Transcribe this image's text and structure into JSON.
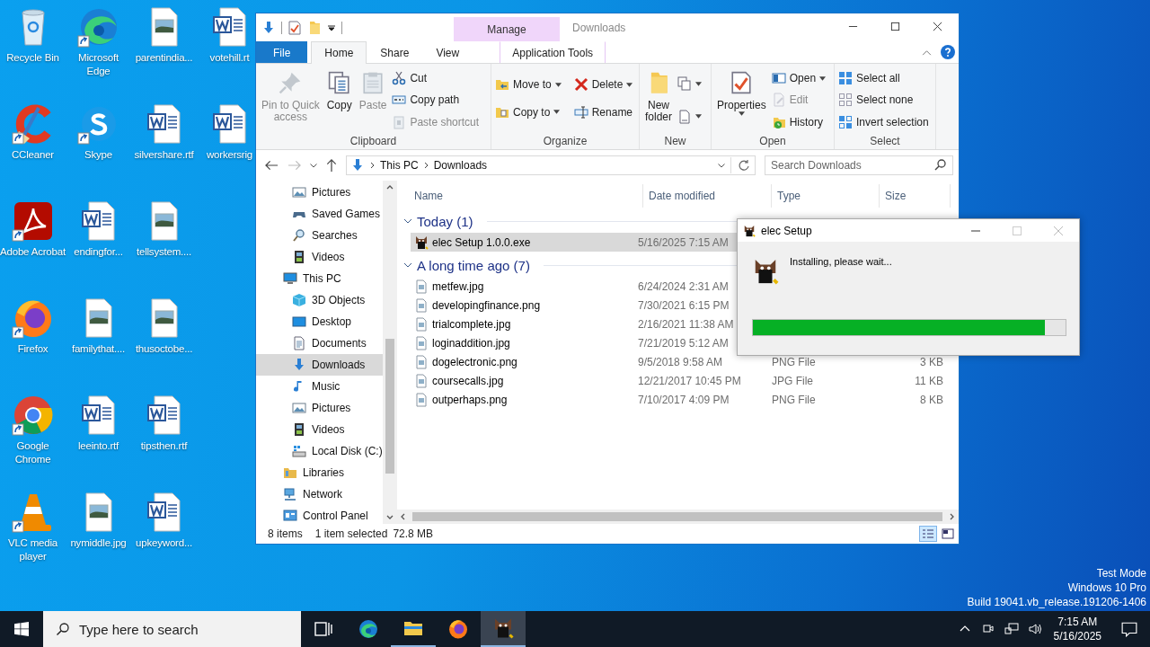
{
  "desktop": {
    "icons": [
      {
        "label": "Recycle Bin",
        "kind": "recycle",
        "shortcut": false
      },
      {
        "label": "CCleaner",
        "kind": "ccleaner",
        "shortcut": true
      },
      {
        "label": "Adobe Acrobat",
        "kind": "acrobat",
        "shortcut": true
      },
      {
        "label": "Firefox",
        "kind": "firefox",
        "shortcut": true
      },
      {
        "label": "Google Chrome",
        "kind": "chrome",
        "shortcut": true
      },
      {
        "label": "VLC media player",
        "kind": "vlc",
        "shortcut": true
      },
      {
        "label": "Microsoft Edge",
        "kind": "edge",
        "shortcut": true
      },
      {
        "label": "Skype",
        "kind": "skype",
        "shortcut": true
      },
      {
        "label": "endingfor...",
        "kind": "word",
        "shortcut": false
      },
      {
        "label": "familythat....",
        "kind": "image",
        "shortcut": false
      },
      {
        "label": "leeinto.rtf",
        "kind": "word",
        "shortcut": false
      },
      {
        "label": "nymiddle.jpg",
        "kind": "image",
        "shortcut": false
      },
      {
        "label": "parentindia...",
        "kind": "image",
        "shortcut": false
      },
      {
        "label": "silvershare.rtf",
        "kind": "word",
        "shortcut": false
      },
      {
        "label": "tellsystem....",
        "kind": "image",
        "shortcut": false
      },
      {
        "label": "thusoctobe...",
        "kind": "image",
        "shortcut": false
      },
      {
        "label": "tipsthen.rtf",
        "kind": "word",
        "shortcut": false
      },
      {
        "label": "upkeyword...",
        "kind": "word",
        "shortcut": false
      },
      {
        "label": "votehill.rt",
        "kind": "word",
        "shortcut": false
      },
      {
        "label": "workersrig",
        "kind": "word",
        "shortcut": false
      }
    ],
    "system_text": [
      "Test Mode",
      "Windows 10 Pro",
      "Build 19041.vb_release.191206-1406"
    ]
  },
  "explorer": {
    "title": "Downloads",
    "context_tab_group": "Manage",
    "tabs": [
      {
        "label": "File",
        "kind": "file",
        "selected": false
      },
      {
        "label": "Home",
        "kind": "tab",
        "selected": true
      },
      {
        "label": "Share",
        "kind": "tab",
        "selected": false
      },
      {
        "label": "View",
        "kind": "tab",
        "selected": false
      },
      {
        "label": "Application Tools",
        "kind": "context",
        "selected": false
      }
    ],
    "ribbon": [
      {
        "name": "Clipboard",
        "large_buttons": [
          {
            "lines": [
              "Pin to Quick",
              "access"
            ],
            "kind": "pin",
            "disabled": true
          },
          {
            "lines": [
              "Copy"
            ],
            "kind": "copy",
            "disabled": false
          },
          {
            "lines": [
              "Paste"
            ],
            "kind": "paste",
            "disabled": true
          }
        ],
        "small_buttons": [
          {
            "label": "Cut",
            "kind": "cut",
            "disabled": false
          },
          {
            "label": "Copy path",
            "kind": "copypath",
            "disabled": false
          },
          {
            "label": "Paste shortcut",
            "kind": "pasteshortcut",
            "disabled": true
          }
        ]
      },
      {
        "name": "Organize",
        "small_buttons": [
          {
            "label": "Move to",
            "kind": "moveto",
            "disabled": false,
            "dropdown": true
          },
          {
            "label": "Copy to",
            "kind": "copyto",
            "disabled": false,
            "dropdown": true
          },
          {
            "label": "Delete",
            "kind": "delete",
            "disabled": false,
            "dropdown": true
          },
          {
            "label": "Rename",
            "kind": "rename",
            "disabled": false
          }
        ]
      },
      {
        "name": "New",
        "large_buttons": [
          {
            "lines": [
              "New",
              "folder"
            ],
            "kind": "newfolder",
            "disabled": false
          }
        ],
        "small_buttons": [
          {
            "kind": "newitem",
            "disabled": false,
            "dropdown": true
          },
          {
            "kind": "easyaccess",
            "disabled": false,
            "dropdown": true
          }
        ]
      },
      {
        "name": "Open",
        "large_buttons": [
          {
            "lines": [
              "Properties"
            ],
            "kind": "properties",
            "disabled": false,
            "dropdown": true
          }
        ],
        "small_buttons": [
          {
            "label": "Open",
            "kind": "open",
            "disabled": false,
            "dropdown": true
          },
          {
            "label": "Edit",
            "kind": "edit",
            "disabled": true
          },
          {
            "label": "History",
            "kind": "history",
            "disabled": false
          }
        ]
      },
      {
        "name": "Select",
        "small_buttons": [
          {
            "label": "Select all",
            "kind": "selectall",
            "disabled": false
          },
          {
            "label": "Select none",
            "kind": "selectnone",
            "disabled": false
          },
          {
            "label": "Invert selection",
            "kind": "invert",
            "disabled": false
          }
        ]
      }
    ],
    "address": [
      "This PC",
      "Downloads"
    ],
    "search": {
      "placeholder": "Search Downloads"
    },
    "navigation": {
      "continued": [
        {
          "label": "Pictures",
          "kind": "pictures",
          "selected": false
        },
        {
          "label": "Saved Games",
          "kind": "savedgames",
          "selected": false
        },
        {
          "label": "Searches",
          "kind": "searches",
          "selected": false
        },
        {
          "label": "Videos",
          "kind": "videos",
          "selected": false
        }
      ],
      "tree": [
        {
          "label": "This PC",
          "kind": "thispc",
          "selected": false,
          "children": [
            {
              "label": "3D Objects",
              "kind": "objects3d",
              "selected": false
            },
            {
              "label": "Desktop",
              "kind": "desktop",
              "selected": false
            },
            {
              "label": "Documents",
              "kind": "documents",
              "selected": false
            },
            {
              "label": "Downloads",
              "kind": "downloads",
              "selected": true
            },
            {
              "label": "Music",
              "kind": "music",
              "selected": false
            },
            {
              "label": "Pictures",
              "kind": "pictures",
              "selected": false
            },
            {
              "label": "Videos",
              "kind": "videos",
              "selected": false
            },
            {
              "label": "Local Disk (C:)",
              "kind": "localdisk",
              "selected": false
            }
          ]
        },
        {
          "label": "Libraries",
          "kind": "libraries",
          "selected": false
        },
        {
          "label": "Network",
          "kind": "network",
          "selected": false
        },
        {
          "label": "Control Panel",
          "kind": "controlpanel",
          "selected": false
        }
      ]
    },
    "columns": [
      "Name",
      "Date modified",
      "Type",
      "Size"
    ],
    "groups": [
      {
        "title": "Today (1)",
        "expanded": true,
        "files": [
          {
            "name": "elec Setup 1.0.0.exe",
            "kind": "app",
            "date": "5/16/2025 7:15 AM",
            "selected": true
          }
        ]
      },
      {
        "title": "A long time ago (7)",
        "expanded": true,
        "files": [
          {
            "name": "metfew.jpg",
            "kind": "image",
            "date": "6/24/2024 2:31 AM",
            "selected": false
          },
          {
            "name": "developingfinance.png",
            "kind": "image",
            "date": "7/30/2021 6:15 PM",
            "selected": false
          },
          {
            "name": "trialcomplete.jpg",
            "kind": "image",
            "date": "2/16/2021 11:38 AM",
            "selected": false
          },
          {
            "name": "loginaddition.jpg",
            "kind": "image",
            "date": "7/21/2019 5:12 AM",
            "selected": false
          },
          {
            "name": "dogelectronic.png",
            "kind": "image",
            "date": "9/5/2018 9:58 AM",
            "type": "PNG File",
            "size": "3 KB",
            "selected": false
          },
          {
            "name": "coursecalls.jpg",
            "kind": "image",
            "date": "12/21/2017 10:45 PM",
            "type": "JPG File",
            "size": "11 KB",
            "selected": false
          },
          {
            "name": "outperhaps.png",
            "kind": "image",
            "date": "7/10/2017 4:09 PM",
            "type": "PNG File",
            "size": "8 KB",
            "selected": false
          }
        ]
      }
    ],
    "status": [
      "8 items",
      "1 item selected",
      "72.8 MB"
    ],
    "views": [
      {
        "kind": "details",
        "selected": true
      },
      {
        "kind": "tiles",
        "selected": false
      }
    ]
  },
  "setup_dialog": {
    "title": "elec Setup",
    "message": "Installing, please wait...",
    "level": 0.934
  },
  "taskbar": {
    "search_placeholder": "Type here to search",
    "apps": [
      {
        "kind": "taskview",
        "running": false,
        "selected": false
      },
      {
        "kind": "edge",
        "running": false,
        "selected": false
      },
      {
        "kind": "explorer",
        "running": true,
        "selected": false
      },
      {
        "kind": "firefox",
        "running": false,
        "selected": false
      },
      {
        "kind": "app",
        "running": true,
        "selected": true
      }
    ],
    "time": "7:15 AM",
    "date": "5/16/2025"
  }
}
